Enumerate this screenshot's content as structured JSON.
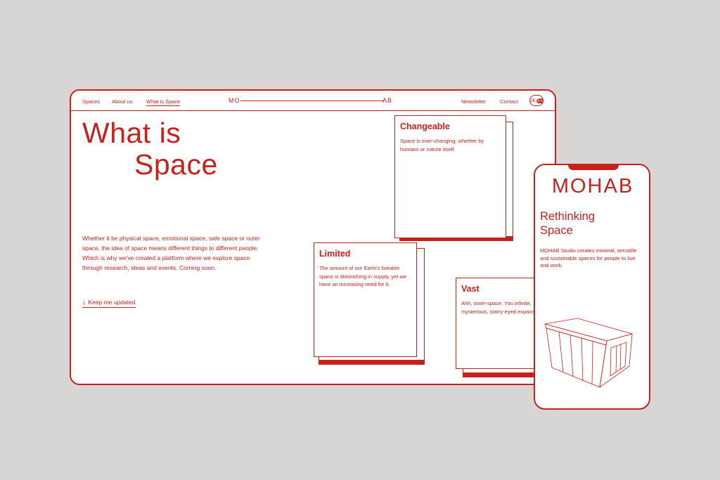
{
  "desktop": {
    "nav": {
      "left": [
        "Spaces",
        "About us",
        "What is Space"
      ],
      "logo_left": "MO",
      "logo_right": "AB",
      "right": [
        "Newsletter",
        "Contact"
      ],
      "lang_de": "DE",
      "lang_en": "EN"
    },
    "hero_line1": "What is",
    "hero_line2": "Space",
    "intro": "Whether it be physical space, emotional space, safe space or outer space, the idea of space means different things to different people. Which is why we've created a platform where we explore space through research, ideas and events. Coming soon.",
    "cta": "Keep me updated",
    "cards": [
      {
        "title": "Changeable",
        "text": "Space is ever-changing, whether by humans or nature itself."
      },
      {
        "title": "Limited",
        "text": "The amount of our Earth's liveable space is diminishing in supply, yet we have an increasing need for it."
      },
      {
        "title": "Vast",
        "text": "Ahh, outer-space. You infinite, mysterious, starry-eyed expanse."
      }
    ]
  },
  "mobile": {
    "logo": "MOHAB",
    "title_line1": "Rethinking",
    "title_line2": "Space",
    "text": "MOHAB Studio creates minimal, versatile and sustainable spaces for people to live and work."
  },
  "colors": {
    "accent": "#c8211b",
    "background": "#d8d6d4"
  }
}
